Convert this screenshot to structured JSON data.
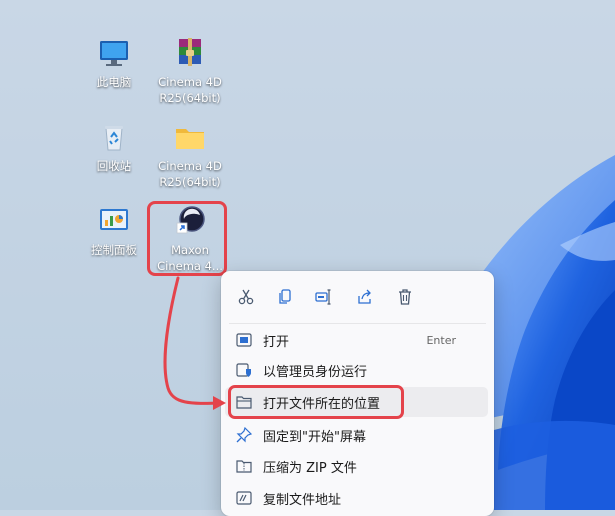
{
  "desktop": {
    "icons": [
      {
        "label": "此电脑"
      },
      {
        "label": "Cinema 4D\nR25(64bit)"
      },
      {
        "label": "回收站"
      },
      {
        "label": "Cinema 4D\nR25(64bit)"
      },
      {
        "label": "控制面板"
      },
      {
        "label": "Maxon\nCinema 4..."
      }
    ]
  },
  "context_menu": {
    "toolbar": [
      {
        "icon": "cut-icon"
      },
      {
        "icon": "copy-icon"
      },
      {
        "icon": "rename-icon"
      },
      {
        "icon": "share-icon"
      },
      {
        "icon": "delete-icon"
      }
    ],
    "items": [
      {
        "label": "打开",
        "shortcut": "Enter"
      },
      {
        "label": "以管理员身份运行"
      },
      {
        "label": "打开文件所在的位置"
      },
      {
        "label": "固定到\"开始\"屏幕"
      },
      {
        "label": "压缩为 ZIP 文件"
      },
      {
        "label": "复制文件地址"
      }
    ]
  },
  "colors": {
    "accent_red": "#e4434b",
    "wallpaper_blue": "#1e5fd8"
  }
}
